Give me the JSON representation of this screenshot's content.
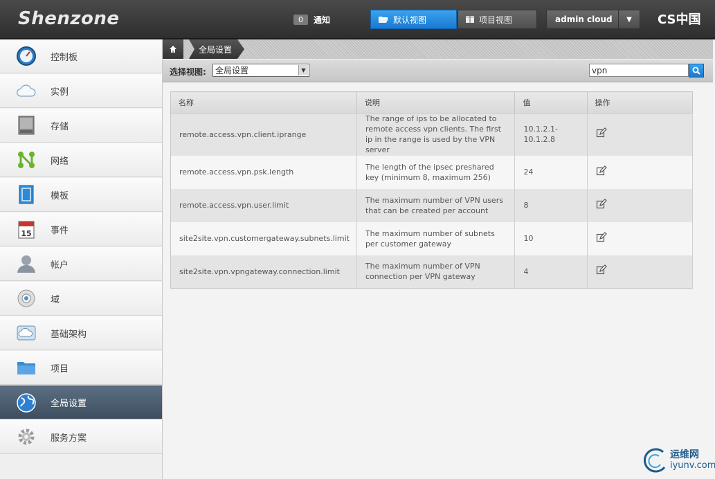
{
  "header": {
    "logo": "Shenzone",
    "notifications": {
      "count": "0",
      "label": "通知"
    },
    "views": {
      "default": "默认视图",
      "project": "项目视图"
    },
    "user": "admin cloud",
    "brand": "CS中国"
  },
  "sidebar": {
    "items": [
      {
        "label": "控制板",
        "icon": "dashboard-icon"
      },
      {
        "label": "实例",
        "icon": "cloud-icon"
      },
      {
        "label": "存储",
        "icon": "storage-icon"
      },
      {
        "label": "网络",
        "icon": "network-icon"
      },
      {
        "label": "模板",
        "icon": "template-icon"
      },
      {
        "label": "事件",
        "icon": "calendar-icon",
        "icon_text": "15"
      },
      {
        "label": "帐户",
        "icon": "user-icon"
      },
      {
        "label": "域",
        "icon": "domain-icon"
      },
      {
        "label": "基础架构",
        "icon": "infrastructure-icon"
      },
      {
        "label": "项目",
        "icon": "folder-icon"
      },
      {
        "label": "全局设置",
        "icon": "globe-icon",
        "active": true
      },
      {
        "label": "服务方案",
        "icon": "gear-icon"
      }
    ]
  },
  "breadcrumb": {
    "current": "全局设置"
  },
  "filter": {
    "label": "选择视图:",
    "selected": "全局设置"
  },
  "search": {
    "value": "vpn"
  },
  "table": {
    "headers": [
      "名称",
      "说明",
      "值",
      "操作"
    ],
    "rows": [
      {
        "name": "remote.access.vpn.client.iprange",
        "description": "The range of ips to be allocated to remote access vpn clients. The first ip in the range is used by the VPN server",
        "value": "10.1.2.1-10.1.2.8"
      },
      {
        "name": "remote.access.vpn.psk.length",
        "description": "The length of the ipsec preshared key (minimum 8, maximum 256)",
        "value": "24"
      },
      {
        "name": "remote.access.vpn.user.limit",
        "description": "The maximum number of VPN users that can be created per account",
        "value": "8"
      },
      {
        "name": "site2site.vpn.customergateway.subnets.limit",
        "description": "The maximum number of subnets per customer gateway",
        "value": "10"
      },
      {
        "name": "site2site.vpn.vpngateway.connection.limit",
        "description": "The maximum number of VPN connection per VPN gateway",
        "value": "4"
      }
    ]
  },
  "watermark": {
    "cn": "运维网",
    "en": "iyunv.com"
  }
}
